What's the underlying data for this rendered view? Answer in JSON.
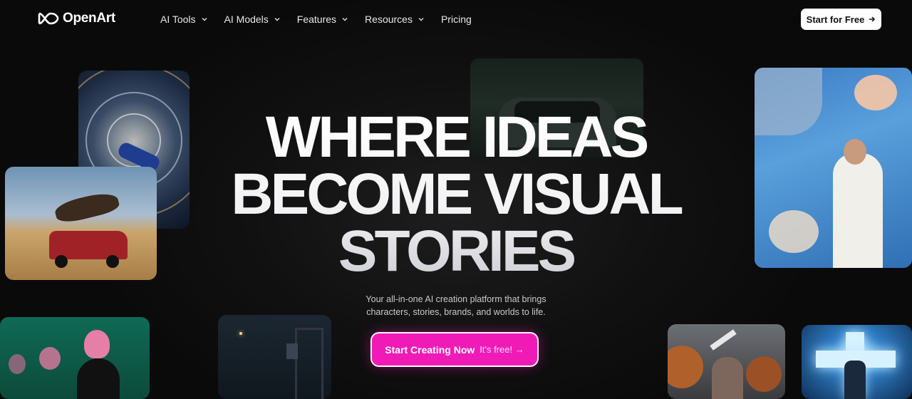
{
  "brand": {
    "name": "OpenArt"
  },
  "nav": {
    "items": [
      {
        "label": "AI Tools",
        "has_dropdown": true
      },
      {
        "label": "AI Models",
        "has_dropdown": true
      },
      {
        "label": "Features",
        "has_dropdown": true
      },
      {
        "label": "Resources",
        "has_dropdown": true
      },
      {
        "label": "Pricing",
        "has_dropdown": false
      }
    ],
    "cta_label": "Start for Free",
    "cta_icon": "arrow-right-icon"
  },
  "hero": {
    "title_lines": [
      "WHERE IDEAS",
      "BECOME VISUAL",
      "STORIES"
    ],
    "subtitle_lines": [
      "Your all-in-one AI creation platform that brings",
      "characters, stories, brands, and worlds to life."
    ],
    "cta_primary": "Start Creating Now",
    "cta_secondary": "It's free! →"
  },
  "gallery": [
    {
      "name": "space-station-image"
    },
    {
      "name": "horse-jump-car-image"
    },
    {
      "name": "car-road-image"
    },
    {
      "name": "flowers-wedding-image"
    },
    {
      "name": "lockers-portrait-image"
    },
    {
      "name": "rain-bus-stop-image"
    },
    {
      "name": "basketball-player-image"
    },
    {
      "name": "cross-light-image"
    }
  ],
  "colors": {
    "background": "#0c0c0c",
    "accent": "#f01bb7",
    "cta_top_bg": "#ffffff"
  }
}
